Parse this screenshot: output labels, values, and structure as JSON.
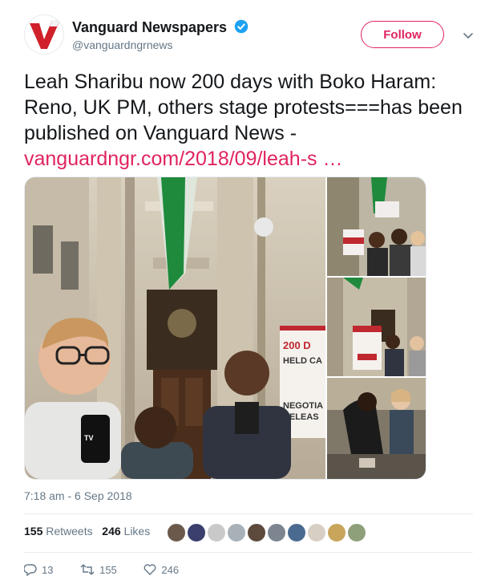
{
  "account": {
    "name": "Vanguard Newspapers",
    "handle": "@vanguardngrnews",
    "follow_label": "Follow",
    "brand_color": "#e0245e"
  },
  "tweet": {
    "text": "Leah Sharibu now 200 days with Boko Haram: Reno, UK PM, others stage protests===has been published on Vanguard News - ",
    "link": "vanguardngr.com/2018/09/leah-s",
    "ellipsis": "…"
  },
  "media": {
    "sign_title": "200 D",
    "sign_line2": "HELD CA",
    "sign_line3": "NEGOTIA",
    "sign_line4": "RELEAS",
    "mic_label": "TV"
  },
  "timestamp": "7:18 am - 6 Sep 2018",
  "stats": {
    "retweets_count": "155",
    "retweets_label": "Retweets",
    "likes_count": "246",
    "likes_label": "Likes"
  },
  "actions": {
    "replies": "13",
    "retweets": "155",
    "likes": "246"
  },
  "avatar_colors": [
    "#6b5a4b",
    "#3b3f6e",
    "#c9c9c9",
    "#a8b0b8",
    "#5d4a3c",
    "#7d8590",
    "#4a6b8f",
    "#d8cfc4",
    "#c8a55a",
    "#8ea07a"
  ]
}
